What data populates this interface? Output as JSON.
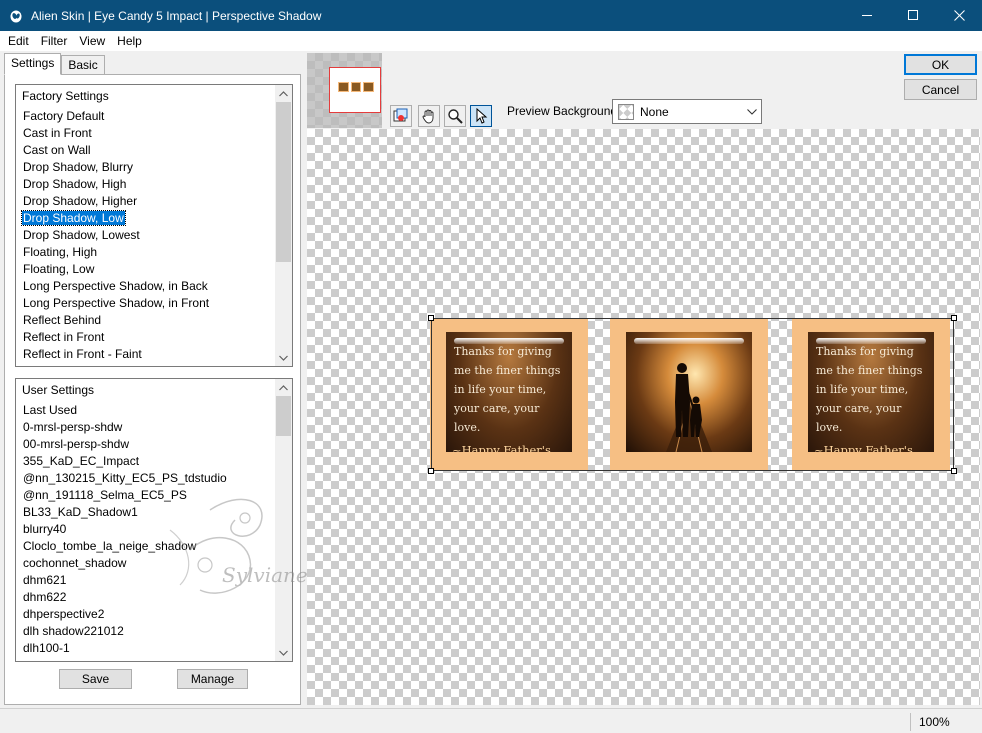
{
  "window": {
    "title": "Alien Skin | Eye Candy 5 Impact | Perspective Shadow"
  },
  "menu": {
    "items": [
      {
        "label": "Edit"
      },
      {
        "label": "Filter"
      },
      {
        "label": "View"
      },
      {
        "label": "Help"
      }
    ]
  },
  "tabs": [
    {
      "label": "Settings",
      "active": true
    },
    {
      "label": "Basic",
      "active": false
    }
  ],
  "factory_settings": {
    "header": "Factory Settings",
    "items": [
      "Factory Default",
      "Cast in Front",
      "Cast on Wall",
      "Drop Shadow, Blurry",
      "Drop Shadow, High",
      "Drop Shadow, Higher",
      "Drop Shadow, Low",
      "Drop Shadow, Lowest",
      "Floating, High",
      "Floating, Low",
      "Long Perspective Shadow, in Back",
      "Long Perspective Shadow, in Front",
      "Reflect Behind",
      "Reflect in Front",
      "Reflect in Front - Faint"
    ],
    "selected": "Drop Shadow, Low"
  },
  "user_settings": {
    "header": "User Settings",
    "items": [
      "Last Used",
      "0-mrsl-persp-shdw",
      "00-mrsl-persp-shdw",
      "355_KaD_EC_Impact",
      "@nn_130215_Kitty_EC5_PS_tdstudio",
      "@nn_191118_Selma_EC5_PS",
      "BL33_KaD_Shadow1",
      "blurry40",
      "Cloclo_tombe_la_neige_shadow",
      "cochonnet_shadow",
      "dhm621",
      "dhm622",
      "dhperspective2",
      "dlh shadow221012",
      "dlh100-1"
    ]
  },
  "buttons": {
    "save": "Save",
    "manage": "Manage",
    "ok": "OK",
    "cancel": "Cancel"
  },
  "preview_background": {
    "label": "Preview Background:",
    "value": "None"
  },
  "toolbar": {
    "tools": [
      "navigator-tool-icon",
      "hand-tool-icon",
      "zoom-tool-icon",
      "pointer-tool-icon"
    ],
    "active_tool": "pointer-tool-icon"
  },
  "preview_image": {
    "panel1_lines": [
      "Thanks for giving",
      "me the finer things",
      "in life your time,",
      "your care, your love."
    ],
    "panel1_signature": "~Happy Father's Day",
    "panel3_lines": [
      "Thanks for giving",
      "me the finer things",
      "in life your time,",
      "your care, your love."
    ],
    "panel3_signature": "~Happy Father's Day"
  },
  "watermark": {
    "text": "Sylviane"
  },
  "status": {
    "zoom": "100%"
  },
  "colors": {
    "titlebar": "#0b4f7c",
    "selection": "#0078d7",
    "frame": "#f6bf84"
  }
}
